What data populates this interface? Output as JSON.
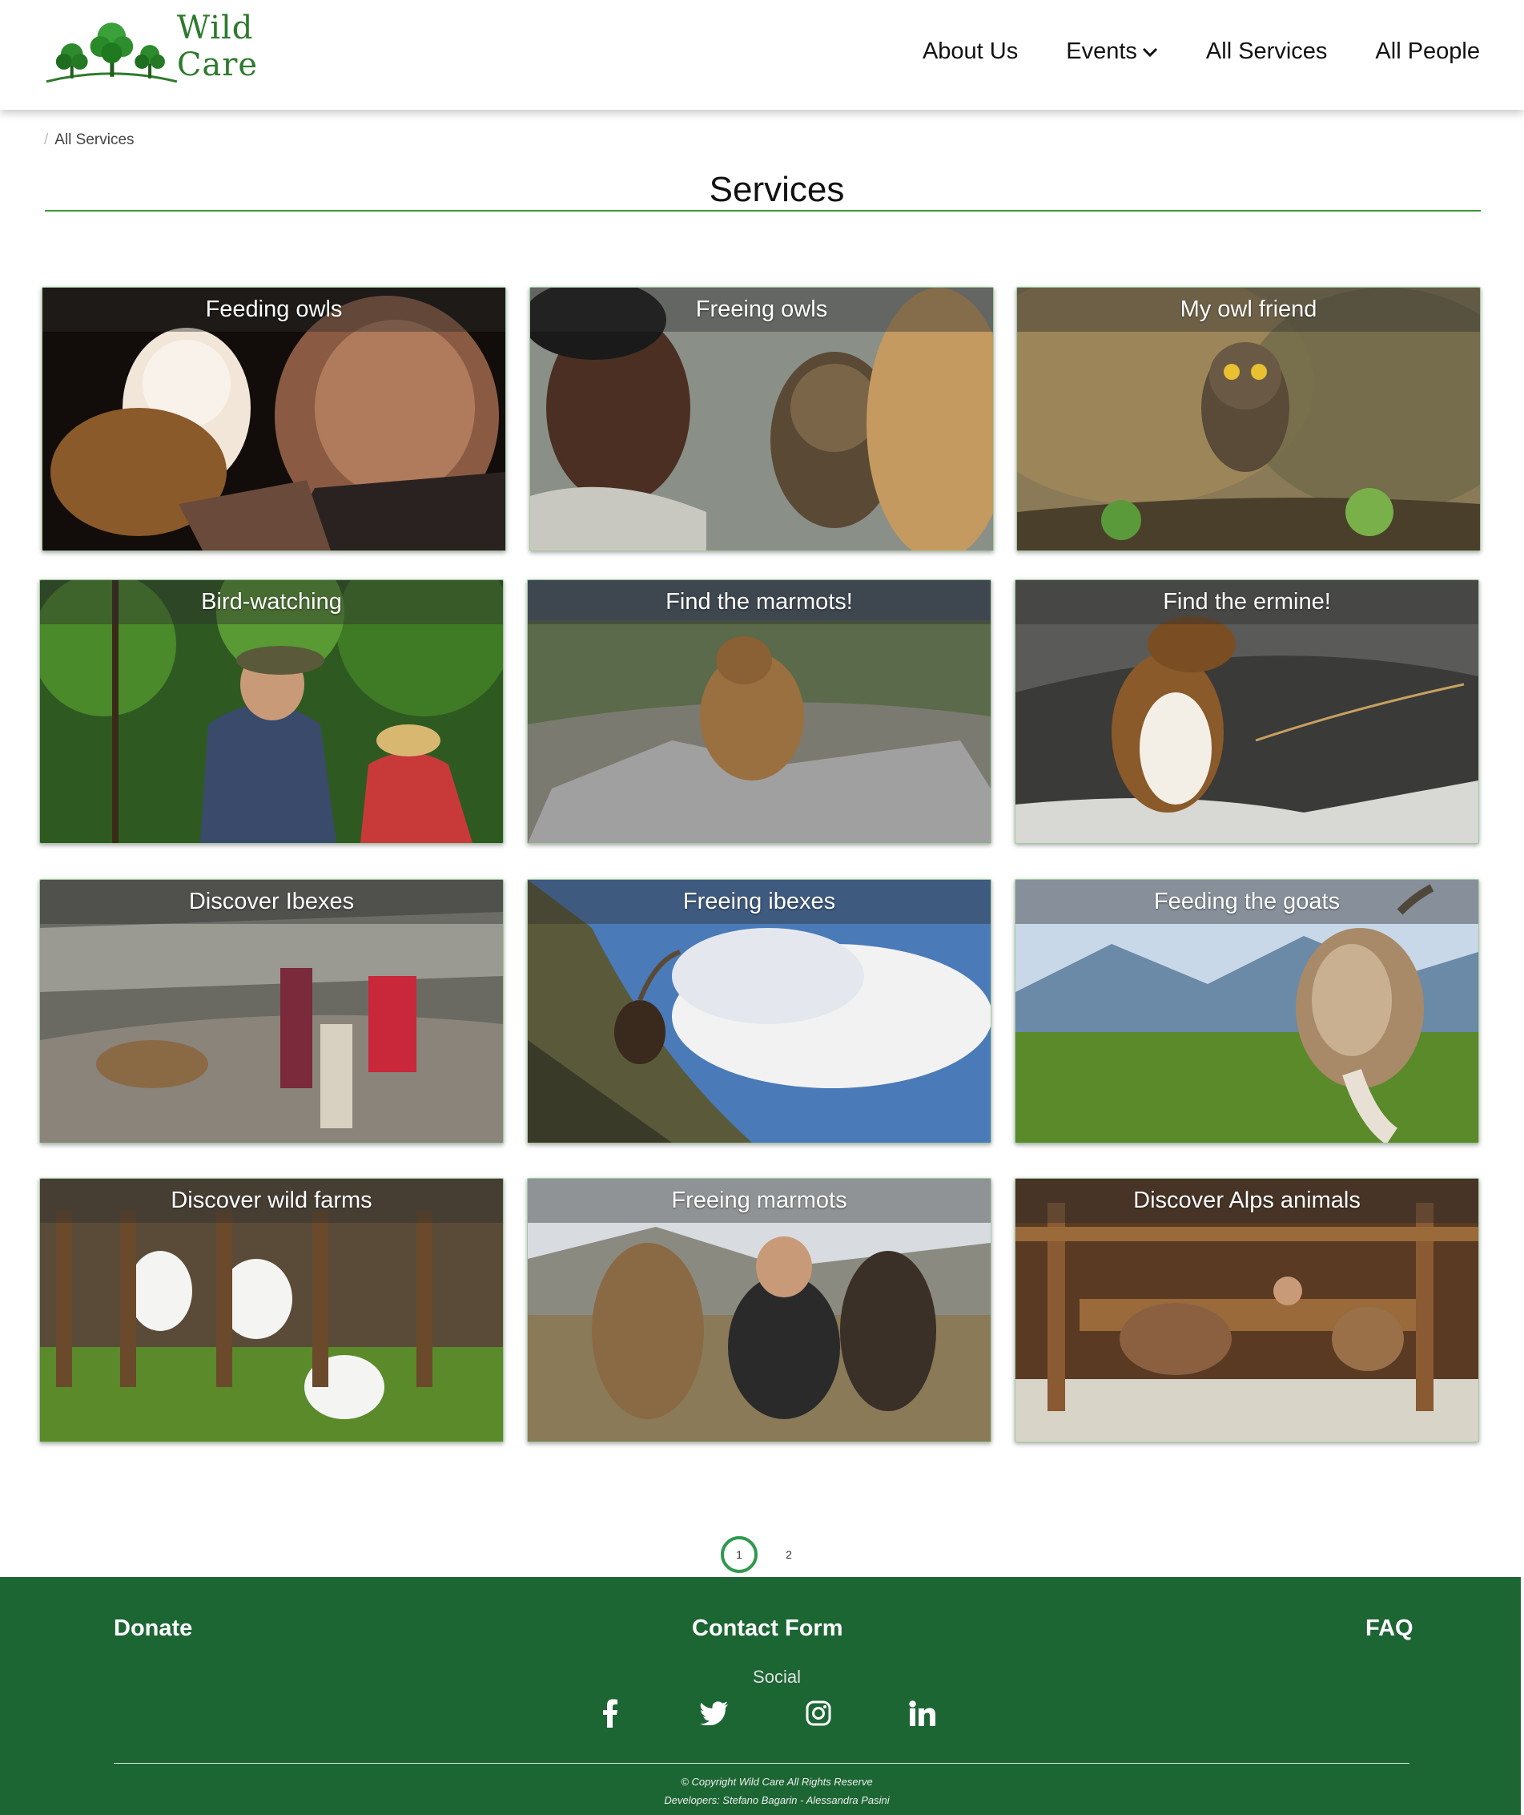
{
  "brand": {
    "name": "Wild Care"
  },
  "nav": {
    "about": "About Us",
    "events": "Events",
    "services": "All Services",
    "people": "All People"
  },
  "breadcrumb": {
    "separator": "/",
    "current": "All Services"
  },
  "page": {
    "title": "Services"
  },
  "services": [
    {
      "label": "Feeding owls"
    },
    {
      "label": "Freeing owls"
    },
    {
      "label": "My owl friend"
    },
    {
      "label": "Bird-watching"
    },
    {
      "label": "Find the marmots!"
    },
    {
      "label": "Find the ermine!"
    },
    {
      "label": "Discover Ibexes"
    },
    {
      "label": "Freeing ibexes"
    },
    {
      "label": "Feeding the goats"
    },
    {
      "label": "Discover wild farms"
    },
    {
      "label": "Freeing marmots"
    },
    {
      "label": "Discover Alps animals"
    }
  ],
  "pagination": {
    "pages": [
      "1",
      "2"
    ],
    "current": "1"
  },
  "footer": {
    "donate": "Donate",
    "contact": "Contact Form",
    "faq": "FAQ",
    "social_heading": "Social",
    "social_icons": [
      "facebook-icon",
      "twitter-icon",
      "instagram-icon",
      "linkedin-icon"
    ],
    "copyright": "© Copyright Wild Care All Rights Reserve",
    "developers": "Developers: Stefano Bagarin - Alessandra Pasini"
  },
  "colors": {
    "brand_green": "#2d7a2d",
    "footer_green": "#1c6633",
    "accent": "#2f9a4f"
  }
}
